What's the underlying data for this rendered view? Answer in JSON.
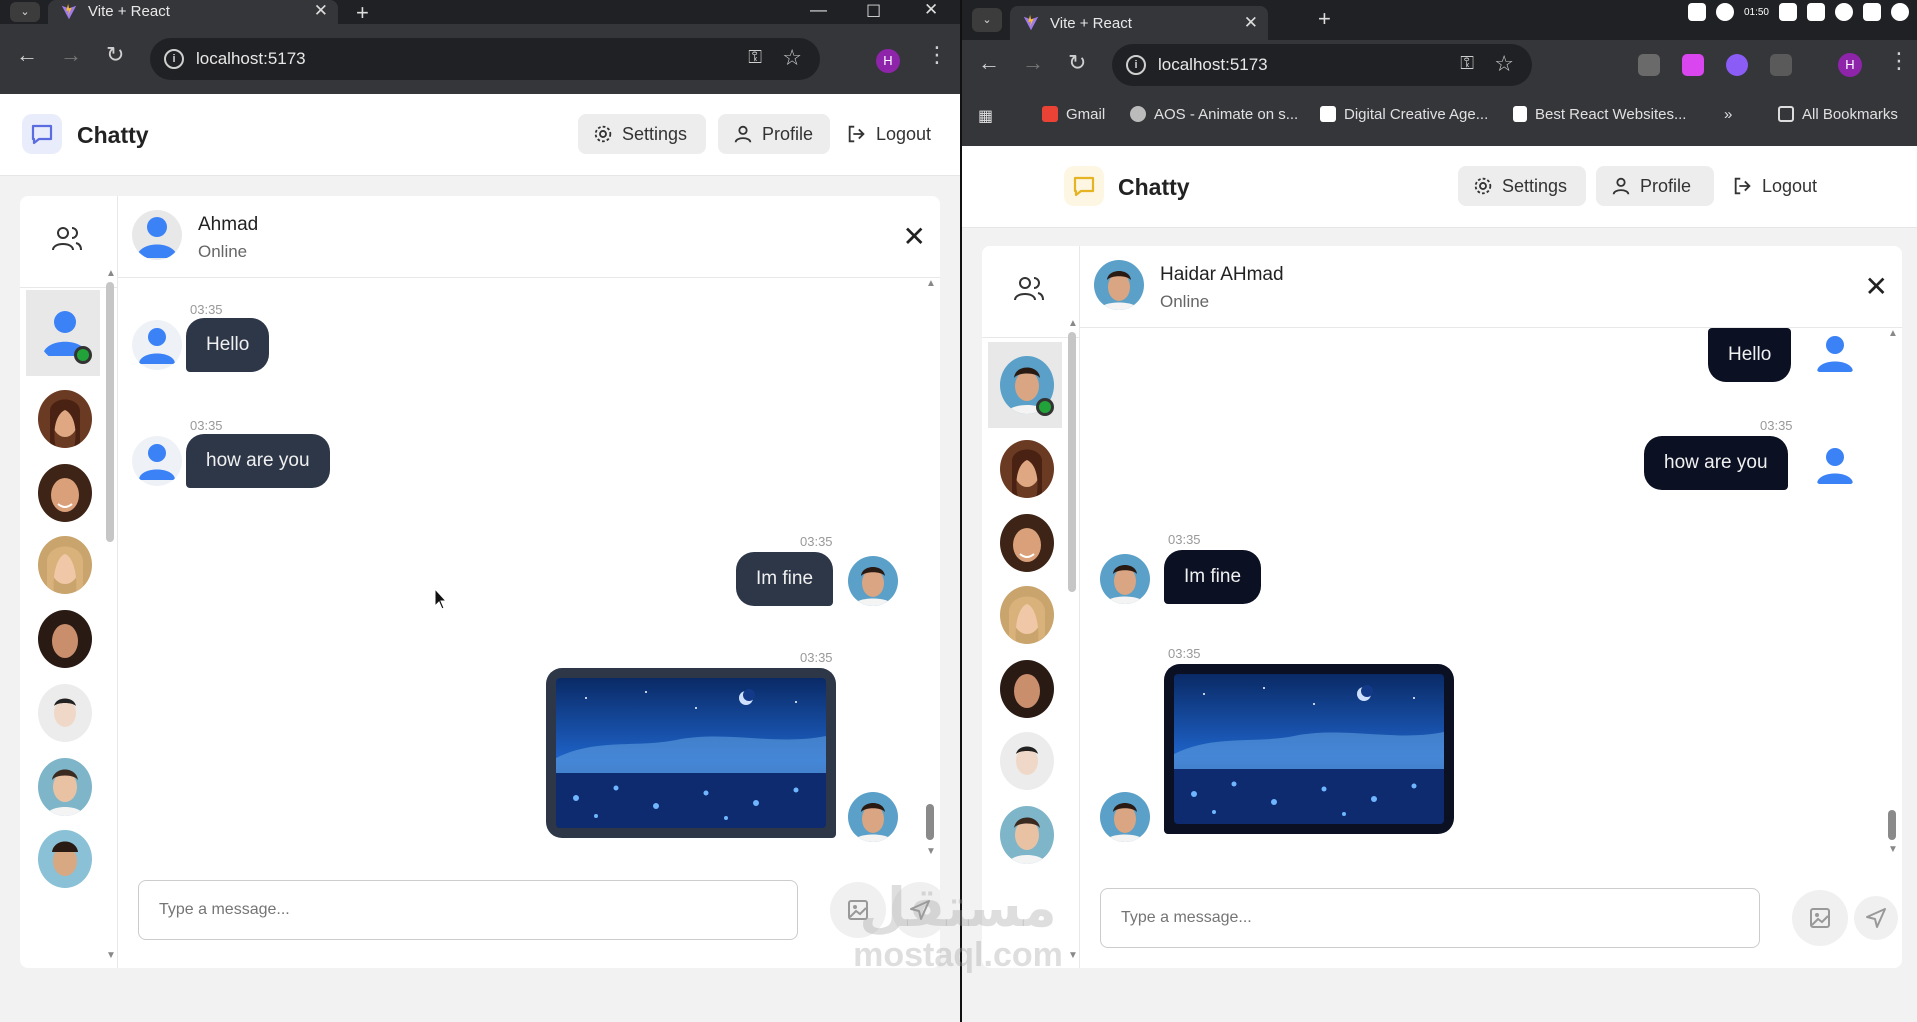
{
  "browser": {
    "tab_title": "Vite + React",
    "url": "localhost:5173",
    "profile_initial": "H",
    "bookmarks": [
      "Gmail",
      "AOS - Animate on s...",
      "Digital Creative Age...",
      "Best React Websites...",
      "»",
      "All Bookmarks"
    ]
  },
  "app": {
    "name": "Chatty",
    "nav": {
      "settings": "Settings",
      "profile": "Profile",
      "logout": "Logout"
    },
    "composer_placeholder": "Type a message..."
  },
  "left": {
    "contact_name": "Ahmad",
    "contact_status": "Online",
    "messages": [
      {
        "time": "03:35",
        "text": "Hello",
        "side": "received"
      },
      {
        "time": "03:35",
        "text": "how are you",
        "side": "received"
      },
      {
        "time": "03:35",
        "text": "Im fine",
        "side": "sent"
      },
      {
        "time": "03:35",
        "text": "",
        "side": "sent",
        "kind": "image"
      }
    ]
  },
  "right": {
    "contact_name": "Haidar AHmad",
    "contact_status": "Online",
    "messages": [
      {
        "time": "",
        "text": "Hello",
        "side": "sent"
      },
      {
        "time": "03:35",
        "text": "how are you",
        "side": "sent"
      },
      {
        "time": "03:35",
        "text": "Im fine",
        "side": "received"
      },
      {
        "time": "03:35",
        "text": "",
        "side": "received",
        "kind": "image"
      }
    ]
  },
  "tray_clock": "01:50",
  "watermark": {
    "arabic": "مستقل",
    "latin": "mostaql.com"
  },
  "colors": {
    "left_logo_bg": "#e9ecfb",
    "left_logo_fg": "#5b6be0",
    "right_logo_bg": "#fdf6e3",
    "right_logo_fg": "#e6b422",
    "online": "#22a33a",
    "left_bubble": "#2d3748",
    "right_bubble": "#0b1023"
  }
}
